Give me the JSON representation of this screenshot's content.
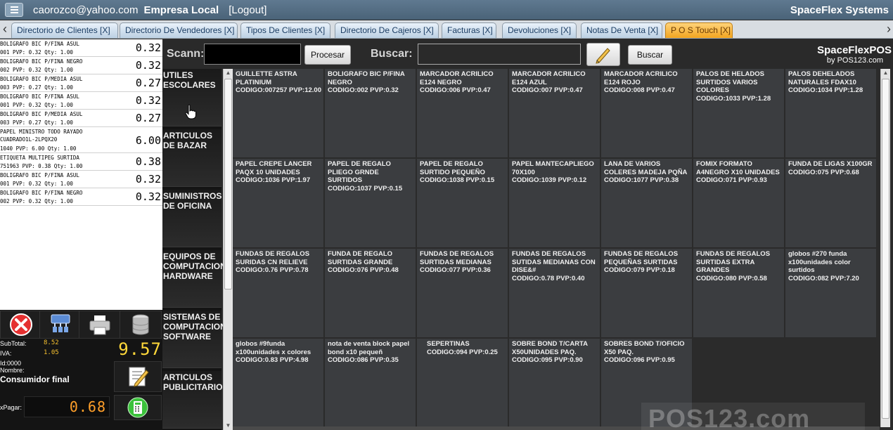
{
  "topbar": {
    "user_email": "caorozco@yahoo.com",
    "company": "Empresa Local",
    "logout": "[Logout]",
    "brand": "SpaceFlex Systems"
  },
  "tabs": [
    {
      "label": "Directorio de Clientes [X]",
      "active": false
    },
    {
      "label": "Directorio De Vendedores [X]",
      "active": false
    },
    {
      "label": "Tipos De Clientes [X]",
      "active": false
    },
    {
      "label": "Directorio De Cajeros [X]",
      "active": false
    },
    {
      "label": "Facturas [X]",
      "active": false
    },
    {
      "label": "Devoluciones [X]",
      "active": false
    },
    {
      "label": "Notas De Venta [X]",
      "active": false
    },
    {
      "label": "P O S Touch [X]",
      "active": true
    }
  ],
  "receipt": {
    "lines": [
      {
        "desc": "BOLIGRAFO BIC P/FINA ASUL",
        "detail": "001  PVP: 0.32 Qty: 1.00",
        "amount": "0.32"
      },
      {
        "desc": "BOLIGRAFO BIC P/FINA NEGRO",
        "detail": "002  PVP: 0.32 Qty: 1.00",
        "amount": "0.32"
      },
      {
        "desc": "BOLIGRAFO BIC P/MEDIA ASUL",
        "detail": "003  PVP: 0.27 Qty: 1.00",
        "amount": "0.27"
      },
      {
        "desc": "BOLIGRAFO BIC P/FINA ASUL",
        "detail": "001  PVP: 0.32 Qty: 1.00",
        "amount": "0.32"
      },
      {
        "desc": "BOLIGRAFO BIC P/MEDIA ASUL",
        "detail": "003  PVP: 0.27 Qty: 1.00",
        "amount": "0.27"
      },
      {
        "desc": "PAPEL MINISTRO TODO RAYADO CUADRADO1L-2LPQX20",
        "detail": "1040  PVP: 6.00 Qty: 1.00",
        "amount": "6.00"
      },
      {
        "desc": "ETIQUETA MULTIPEG SURTIDA",
        "detail": "751963  PVP: 0.38 Qty: 1.00",
        "amount": "0.38"
      },
      {
        "desc": "BOLIGRAFO BIC P/FINA ASUL",
        "detail": "001  PVP: 0.32 Qty: 1.00",
        "amount": "0.32"
      },
      {
        "desc": "BOLIGRAFO BIC P/FINA NEGRO",
        "detail": "002  PVP: 0.32 Qty: 1.00",
        "amount": "0.32"
      }
    ]
  },
  "totals": {
    "subtotal_label": "SubTotal:",
    "subtotal_value": "8.52",
    "iva_label": "IVA:",
    "iva_value": "1.05",
    "total_value": "9.57",
    "id_label": "Id:0000",
    "name_label": "Nombre:",
    "client_name": "Consumidor final",
    "pay_label": "xPagar:",
    "pay_value": "0.68"
  },
  "actions": {
    "icons": [
      "cancel-icon",
      "network-icon",
      "printer-icon",
      "database-icon",
      "edit-notes-icon",
      "calculator-icon"
    ]
  },
  "header": {
    "scan_label": "Scann:",
    "scan_value": "",
    "process_button": "Procesar",
    "search_label": "Buscar:",
    "search_value": "",
    "search_button": "Buscar",
    "brand_main": "SpaceFlexPOS",
    "brand_sub": "by POS123.com"
  },
  "categories": [
    {
      "label": "UTILES ESCOLARES"
    },
    {
      "label": "ARTICULOS DE BAZAR"
    },
    {
      "label": "SUMINISTROS DE OFICINA"
    },
    {
      "label": "EQUIPOS DE COMPUTACION HARDWARE"
    },
    {
      "label": "SISTEMAS DE COMPUTACION SOFTWARE"
    },
    {
      "label": "ARTICULOS PUBLICITARIOS"
    }
  ],
  "products": [
    {
      "name": "GUILLETTE ASTRA PLATINIUM",
      "code": "CODIGO:007257 PVP:12.00"
    },
    {
      "name": "BOLIGRAFO BIC P/FINA NEGRO",
      "code": "CODIGO:002 PVP:0.32"
    },
    {
      "name": "MARCADOR ACRILICO E124 NEGRO",
      "code": "CODIGO:006 PVP:0.47"
    },
    {
      "name": "MARCADOR ACRILICO E124 AZUL",
      "code": "CODIGO:007 PVP:0.47"
    },
    {
      "name": "MARCADOR ACRILICO E124 ROJO",
      "code": "CODIGO:008 PVP:0.47"
    },
    {
      "name": "PALOS DE HELADOS SURTIDOS VARIOS COLORES",
      "code": "CODIGO:1033 PVP:1.28"
    },
    {
      "name": "PALOS DEHELADOS NATURALES FDAX10",
      "code": "CODIGO:1034 PVP:1.28"
    },
    {
      "name": "PAPEL CREPE LANCER PAQX 10 UNIDADES",
      "code": "CODIGO:1036 PVP:1.97"
    },
    {
      "name": "PAPEL DE REGALO PLIEGO GRNDE SURTIDOS",
      "code": "CODIGO:1037 PVP:0.15"
    },
    {
      "name": "PAPEL DE REGALO SURTIDO PEQUEÑO",
      "code": "CODIGO:1038 PVP:0.15"
    },
    {
      "name": "PAPEL MANTECAPLIEGO 70X100",
      "code": "CODIGO:1039 PVP:0.12"
    },
    {
      "name": "LANA DE VARIOS COLERES MADEJA PQÑA",
      "code": "CODIGO:1077 PVP:0.38"
    },
    {
      "name": "FOMIX FORMATO A4NEGRO X10 UNIDADES",
      "code": "CODIGO:071 PVP:0.93"
    },
    {
      "name": "FUNDA DE LIGAS X100GR",
      "code": "CODIGO:075 PVP:0.68"
    },
    {
      "name": "FUNDAS DE REGALOS SURIDAS CN RELIEVE",
      "code": "CODIGO:0.76 PVP:0.78"
    },
    {
      "name": "FUNDA DE REGALO SURTIDAS GRANDE",
      "code": "CODIGO:076 PVP:0.48"
    },
    {
      "name": "FUNDAS DE REGALOS SURTIDAS MEDIANAS",
      "code": "CODIGO:077 PVP:0.36"
    },
    {
      "name": "FUNDAS DE REGALOS SUTIDAS MEDIANAS CON DISE&#",
      "code": "CODIGO:0.78 PVP:0.40"
    },
    {
      "name": "FUNDAS DE REGALOS PEQUEÑAS SURTIDAS",
      "code": "CODIGO:079 PVP:0.18"
    },
    {
      "name": "FUNDAS DE REGALOS SURTIDAS EXTRA GRANDES",
      "code": "CODIGO:080 PVP:0.58"
    },
    {
      "name": "globos #270 funda x100unidades color surtidos",
      "code": "CODIGO:082 PVP:7.20"
    },
    {
      "name": "globos #9funda x100unidades x colores",
      "code": "CODIGO:0.83 PVP:4.98"
    },
    {
      "name": "nota de venta block papel bond x10 pequeñ",
      "code": "CODIGO:086 PVP:0.35"
    },
    {
      "name": "SEPERTINAS",
      "code": "CODIGO:094 PVP:0.25"
    },
    {
      "name": "SOBRE BOND T/CARTA X50UNIDADES PAQ.",
      "code": "CODIGO:095 PVP:0.90"
    },
    {
      "name": "SOBRES BOND T/OFICIO X50 PAQ.",
      "code": "CODIGO:096 PVP:0.95"
    }
  ],
  "watermark": "POS123.com"
}
